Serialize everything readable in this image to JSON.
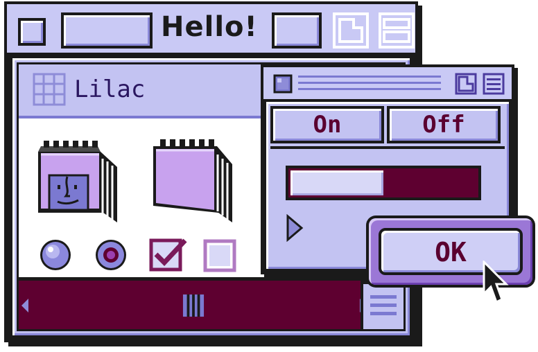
{
  "main_window": {
    "title": "Hello!",
    "pane": {
      "title": "Lilac"
    }
  },
  "controls": {
    "radio_unselected": false,
    "radio_selected": true,
    "checkbox_checked": true,
    "checkbox_unchecked": false
  },
  "second_window": {
    "segmented": {
      "on_label": "On",
      "off_label": "Off",
      "selected": "On"
    },
    "progress": 0.5
  },
  "dialog": {
    "ok_label": "OK"
  },
  "icons": [
    "close-box-icon",
    "zoom-box-icon",
    "collapse-box-icon",
    "grid-view-icon",
    "finder-book-icon",
    "book-icon",
    "disclosure-triangle-icon",
    "scroll-arrow-left-icon",
    "scroll-arrow-right-icon",
    "resize-grip-icon",
    "arrow-cursor-icon"
  ],
  "colors": {
    "lilac": "#c9c9f5",
    "plum": "#5e0030",
    "accent": "#5a0030",
    "outline": "#1a1a1a"
  }
}
